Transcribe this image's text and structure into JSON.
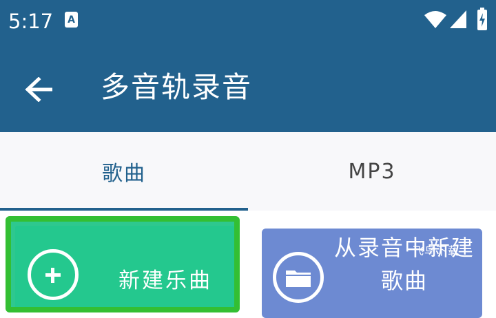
{
  "status_bar": {
    "time": "5:17",
    "notification_icon": "a-letter-icon",
    "notification_icon_glyph": "A",
    "icons": [
      "wifi-icon",
      "cell-signal-icon",
      "battery-charging-icon"
    ]
  },
  "app_bar": {
    "title": "多音轨录音",
    "back_icon": "arrow-left-icon"
  },
  "tabs": [
    {
      "label": "歌曲",
      "selected": true
    },
    {
      "label": "MP3",
      "selected": false
    }
  ],
  "buttons": {
    "new_song": {
      "label": "新建乐曲",
      "icon": "plus-circle-icon"
    },
    "from_recording": {
      "label": "从录音中新建歌曲",
      "icon": "folder-icon"
    }
  },
  "watermark": "飞鸟下载",
  "colors": {
    "primary": "#22618d",
    "tab_background": "#f8f8fa",
    "new_song_fill": "#24c88e",
    "new_song_border": "#33bf33",
    "from_recording_fill": "#6d8ad2",
    "text_on_primary": "#ffffff"
  }
}
